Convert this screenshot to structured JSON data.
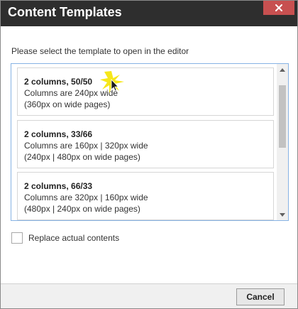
{
  "dialog": {
    "title": "Content Templates",
    "prompt": "Please select the template to open in the editor"
  },
  "templates": [
    {
      "name": "2 columns, 50/50",
      "line1": "Columns are 240px wide",
      "line2": "(360px on wide pages)"
    },
    {
      "name": "2 columns, 33/66",
      "line1": "Columns are 160px | 320px wide",
      "line2": "(240px | 480px on wide pages)"
    },
    {
      "name": "2 columns, 66/33",
      "line1": "Columns are 320px | 160px wide",
      "line2": "(480px | 240px on wide pages)"
    }
  ],
  "replace_option": {
    "label": "Replace actual contents",
    "checked": false
  },
  "footer": {
    "cancel_label": "Cancel"
  },
  "colors": {
    "titlebar": "#2e2e2e",
    "close_button": "#c75050",
    "list_border": "#87b3e4",
    "cursor_highlight": "#f5e400"
  }
}
